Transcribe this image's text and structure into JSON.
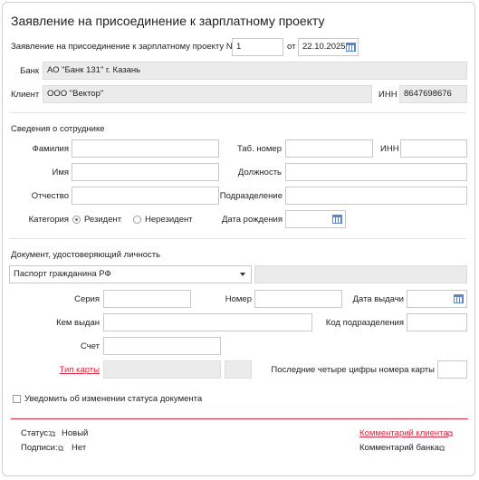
{
  "title": "Заявление на присоединение к зарплатному проекту",
  "header": {
    "statement_label": "Заявление на присоединение к зарплатному проекту N",
    "number": "1",
    "date_prefix": "от",
    "date": "22.10.2025"
  },
  "bank": {
    "label": "Банк",
    "value": "АО \"Банк 131\" г. Казань"
  },
  "client": {
    "label": "Клиент",
    "value": "ООО \"Вектор\"",
    "inn_label": "ИНН",
    "inn": "8647698676"
  },
  "employee": {
    "section_title": "Сведения о сотруднике",
    "surname_label": "Фамилия",
    "tab_label": "Таб. номер",
    "inn_label": "ИНН",
    "name_label": "Имя",
    "position_label": "Должность",
    "patronymic_label": "Отчество",
    "department_label": "Подразделение",
    "category_label": "Категория",
    "resident_label": "Резидент",
    "nonresident_label": "Нерезидент",
    "category_selected": "Резидент",
    "birth_label": "Дата рождения"
  },
  "document": {
    "section_title": "Документ, удостоверяющий личность",
    "type_value": "Паспорт гражданина РФ",
    "series_label": "Серия",
    "number_label": "Номер",
    "issue_date_label": "Дата выдачи",
    "issued_by_label": "Кем выдан",
    "dept_code_label": "Код подразделения",
    "account_label": "Счет",
    "card_type_label": "Тип карты",
    "last_digits_label": "Последние четыре цифры номера карты"
  },
  "notify_label": "Уведомить об изменении статуса документа",
  "footer": {
    "status_label": "Статус:",
    "status_value": "Новый",
    "signatures_label": "Подписи:",
    "signatures_value": "Нет",
    "client_comment": "Комментарий клиента",
    "bank_comment": "Комментарий банка"
  },
  "colors": {
    "accent": "#d7263d",
    "calendar": "#5a86c8"
  },
  "icons": {
    "calendar": "calendar-icon",
    "external": "open-window-icon",
    "dropdown": "caret-down-icon"
  }
}
